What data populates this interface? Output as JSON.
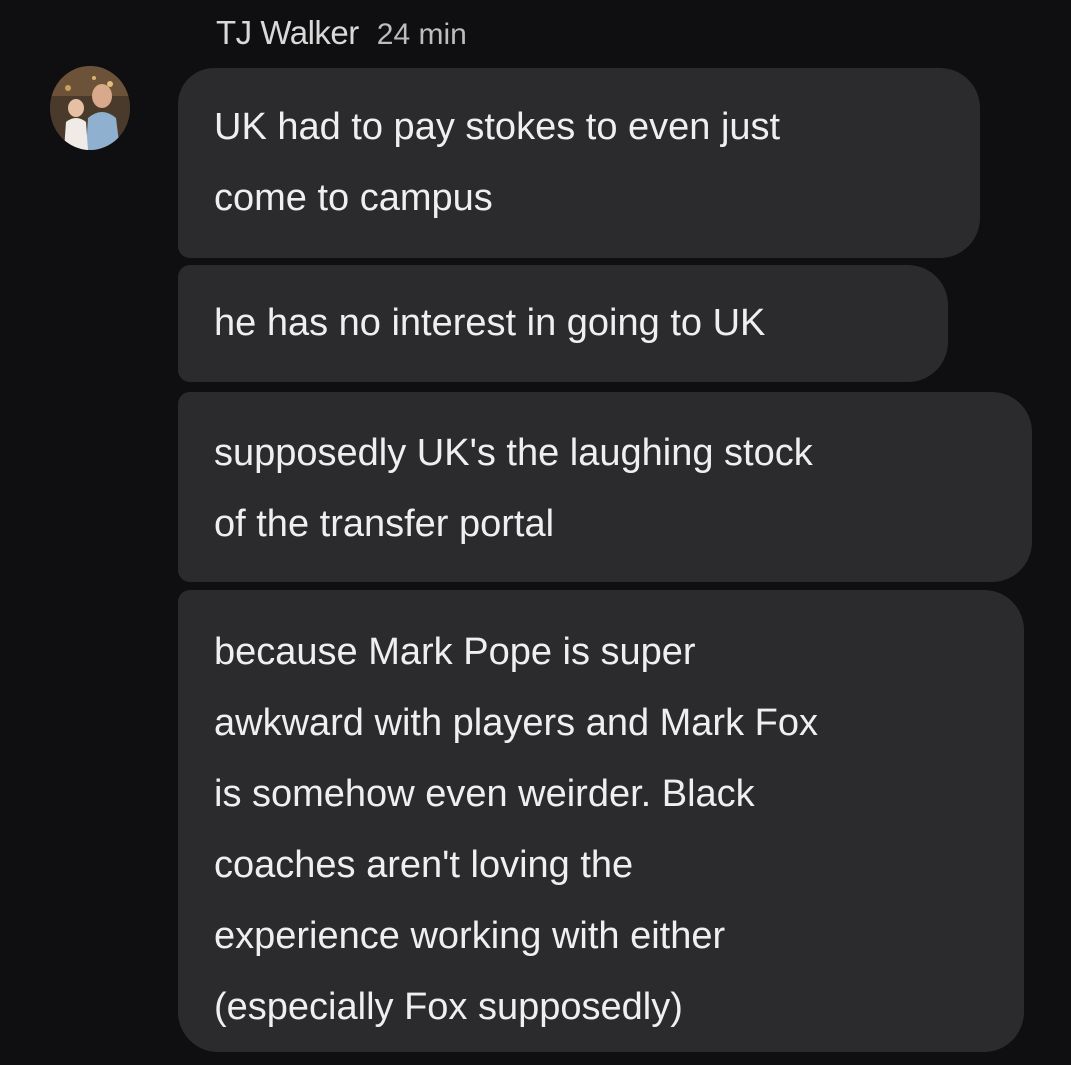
{
  "conversation": {
    "sender": "TJ Walker",
    "timestamp": "24 min",
    "messages": [
      {
        "lines": [
          "UK had to pay stokes to even just",
          "come to campus"
        ]
      },
      {
        "lines": [
          "he has no interest in going to UK"
        ]
      },
      {
        "lines": [
          "supposedly UK's the laughing stock",
          "of the transfer portal"
        ]
      },
      {
        "lines": [
          "because Mark Pope is super",
          "awkward with players and Mark Fox",
          "is somehow even weirder. Black",
          "coaches aren't loving the",
          "experience working with either",
          "(especially Fox supposedly)"
        ]
      }
    ]
  },
  "colors": {
    "background": "#0f0e10",
    "bubble": "#2b2a2d",
    "text": "#efefef",
    "meta_text": "#bdbdbd"
  }
}
